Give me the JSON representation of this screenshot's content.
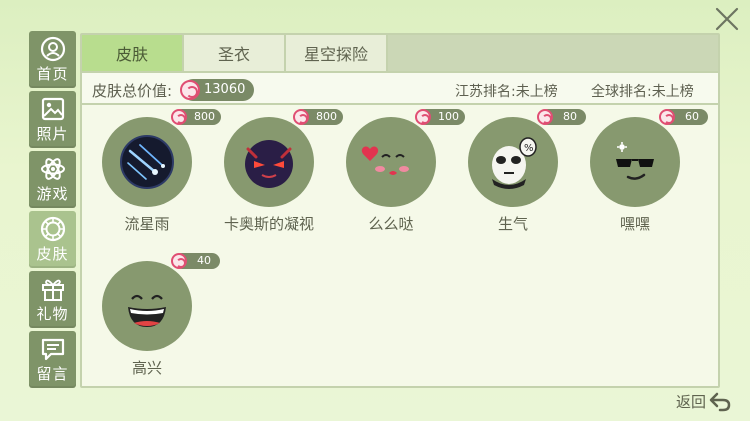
{
  "sidebar": {
    "items": [
      {
        "label": "首页",
        "icon": "user-icon",
        "active": false
      },
      {
        "label": "照片",
        "icon": "photo-icon",
        "active": false
      },
      {
        "label": "游戏",
        "icon": "atom-icon",
        "active": false
      },
      {
        "label": "皮肤",
        "icon": "ring-icon",
        "active": true
      },
      {
        "label": "礼物",
        "icon": "gift-icon",
        "active": false
      },
      {
        "label": "留言",
        "icon": "message-icon",
        "active": false
      }
    ]
  },
  "tabs": [
    {
      "label": "皮肤",
      "active": true
    },
    {
      "label": "圣衣",
      "active": false
    },
    {
      "label": "星空探险",
      "active": false
    }
  ],
  "summary": {
    "value_label": "皮肤总价值:",
    "value": "13060",
    "rank_jiangsu": "江苏排名:未上榜",
    "rank_global": "全球排名:未上榜"
  },
  "skins": [
    {
      "name": "流星雨",
      "price": "800",
      "icon": "meteor-icon"
    },
    {
      "name": "卡奥斯的凝视",
      "price": "800",
      "icon": "demon-eye-icon"
    },
    {
      "name": "么么哒",
      "price": "100",
      "icon": "kiss-face-icon"
    },
    {
      "name": "生气",
      "price": "80",
      "icon": "angry-panda-icon"
    },
    {
      "name": "嘿嘿",
      "price": "60",
      "icon": "sunglasses-face-icon"
    },
    {
      "name": "高兴",
      "price": "40",
      "icon": "laughing-face-icon"
    }
  ],
  "back_label": "返回",
  "colors": {
    "accent": "#b8dd8e",
    "candy": "#e04e73",
    "disc": "#87996f"
  }
}
